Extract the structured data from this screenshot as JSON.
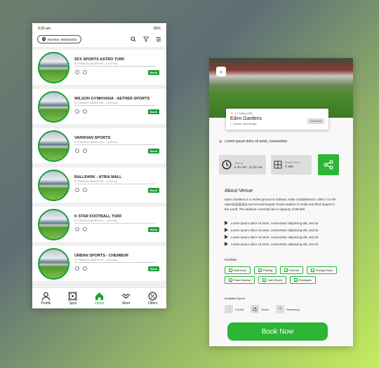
{
  "list_screen": {
    "status_time": "9:30 am",
    "battery": "80%",
    "location": "Mumbai, Maharastra",
    "cards": [
      {
        "name": "SFX SPORTS ASTRO TURF",
        "address": "ST FRANCIS XAVIER HIG... ( 40.5 km)",
        "book": "Book"
      },
      {
        "name": "WILSON GYMKHANA - AETHER SPORTS",
        "address": "ST FRANCIS XAVIER HIG... ( 40.5 km)",
        "book": "Book"
      },
      {
        "name": "VARDHAN SPORTS",
        "address": "ST FRANCIS XAVIER HIG... ( 40.5 km)",
        "book": "Book"
      },
      {
        "name": "BALLPARK - ATRIA MALL",
        "address": "ST FRANCIS XAVIER HIG... ( 40.5 km)",
        "book": "Book"
      },
      {
        "name": "K STAR FOOTBALL TURF",
        "address": "ST FRANCIS XAVIER HIG... ( 40.5 km)",
        "book": "Book"
      },
      {
        "name": "URBAN SPORTS - CHEMBUR",
        "address": "ST FRANCIS XAVIER HIG... ( 40.5 km)",
        "book": "Book"
      }
    ],
    "nav": [
      {
        "label": "Profile",
        "icon": "profile-icon"
      },
      {
        "label": "Spot",
        "icon": "ball-icon"
      },
      {
        "label": "Home",
        "icon": "home-icon",
        "active": true
      },
      {
        "label": "Meet",
        "icon": "handshake-icon"
      },
      {
        "label": "Offers",
        "icon": "discount-icon"
      }
    ]
  },
  "detail_screen": {
    "rating": "4.7 Rating (138)",
    "venue_name": "Eden Gardens",
    "venue_location": "Kolkata, West Bengal",
    "get_directions": "Get Route",
    "short_desc": "Lorem ipsum dolor sit amet, consectetur",
    "timing_label": "Timing",
    "timing_value": "6.30 AM - 12.30 AM",
    "starts_label": "Starts From",
    "starts_value": "₹ 490",
    "about_title": "About Venue",
    "about_text": "Eden Gardens is a cricket ground in Kolkata, India. Established in 1864, it is the oldest[1][2][3][4] and second-largest cricket stadium in India and third largest in the world. The stadium currently has a capacity of 68,000.",
    "bullets": [
      "Lorem ipsum dolor sit amet, consectetur adipiscing elit, sed do",
      "Lorem ipsum dolor sit amet, consectetur adipiscing elit, sed do",
      "Lorem ipsum dolor sit amet, consectetur adipiscing elit, sed do",
      "Lorem ipsum dolor sit amet, consectetur adipiscing elit, sed do"
    ],
    "facilities_title": "Facilities",
    "facilities": [
      "Washroom",
      "Parking",
      "First Aid",
      "Change Room",
      "Power Backup",
      "Cafe (Food)",
      "Floodlights"
    ],
    "sports_title": "Available Sports",
    "sports": [
      "Cricket",
      "Kickin",
      "Swimming"
    ],
    "book_now": "Book Now"
  },
  "colors": {
    "accent": "#2db535",
    "dark_green": "#1e9e3a"
  }
}
